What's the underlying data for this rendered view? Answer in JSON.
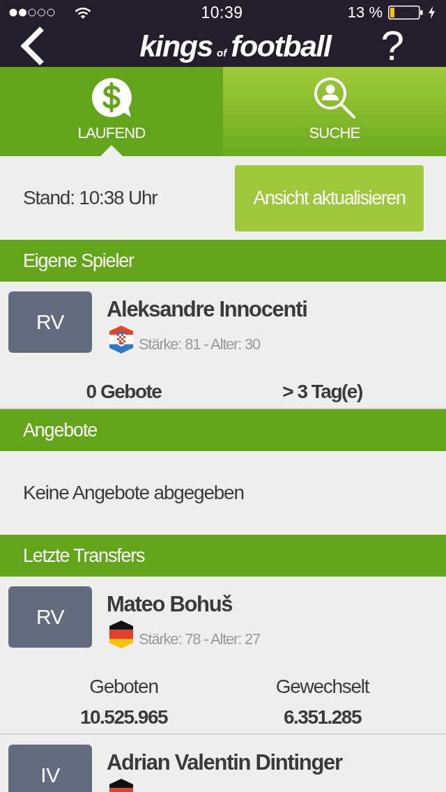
{
  "status_bar": {
    "time": "10:39",
    "battery": "13 %"
  },
  "nav_bar": {
    "logo": [
      "kings",
      "of",
      "football"
    ],
    "help": "?"
  },
  "tabs": [
    {
      "kind": "bids",
      "label": "LAUFEND",
      "selected": true
    },
    {
      "kind": "search",
      "label": "SUCHE",
      "selected": false
    }
  ],
  "refresh": {
    "timestamp": "Stand: 10:38 Uhr",
    "button": "Ansicht aktualisieren"
  },
  "sections": [
    {
      "title": "Eigene Spieler",
      "players": [
        {
          "position": "RV",
          "name": "Aleksandre Innocenti",
          "flag": {
            "kind": "croatia"
          },
          "details": "Stärke: 81 - Alter: 30",
          "stats": [
            {
              "value": "0 Gebote"
            },
            {
              "value": "> 3 Tag(e)"
            }
          ]
        }
      ]
    },
    {
      "title": "Angebote",
      "empty_text": "Keine Angebote abgegeben"
    },
    {
      "title": "Letzte Transfers",
      "players": [
        {
          "position": "RV",
          "name": "Mateo Bohuš",
          "flag": {
            "kind": "germany"
          },
          "details": "Stärke: 78 - Alter: 27",
          "stats": [
            {
              "label": "Geboten",
              "value": "10.525.965"
            },
            {
              "label": "Gewechselt",
              "value": "6.351.285"
            }
          ]
        },
        {
          "position": "IV",
          "name": "Adrian Valentin Dintinger",
          "flag": {
            "kind": "germany"
          }
        }
      ]
    }
  ]
}
